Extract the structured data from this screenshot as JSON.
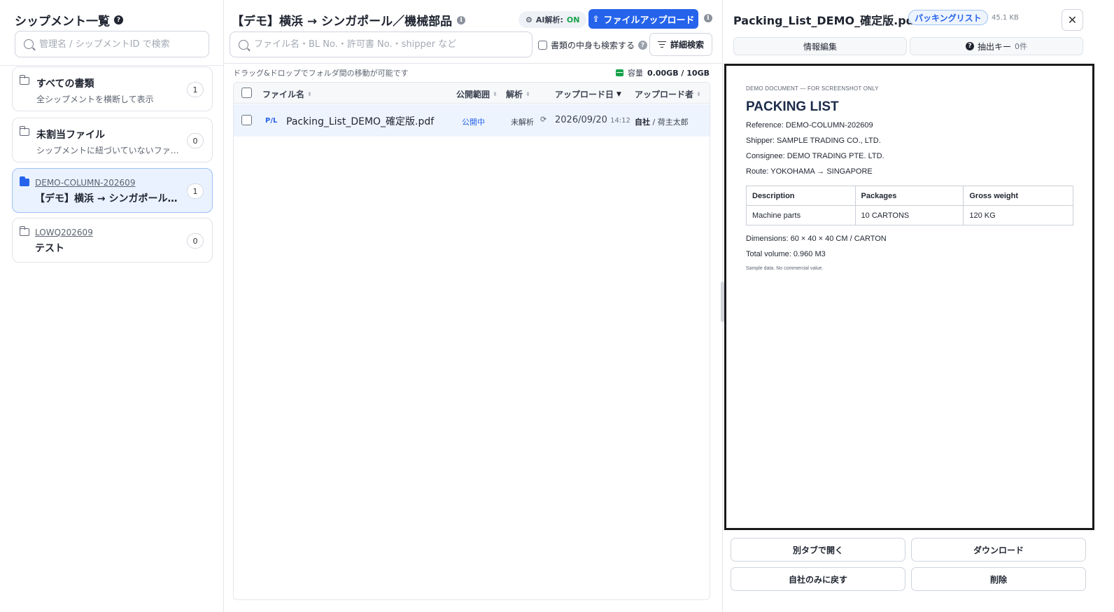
{
  "sidebar": {
    "title": "シップメント一覧",
    "search_placeholder": "管理名 / シップメントID で検索",
    "folders": [
      {
        "title": "すべての書類",
        "subtitle": "全シップメントを横断して表示",
        "count": "1"
      },
      {
        "title": "未割当ファイル",
        "subtitle": "シップメントに紐づいていないファイル",
        "count": "0"
      },
      {
        "id": "DEMO-COLUMN-202609",
        "name": "【デモ】横浜 → シンガポール／機械部品",
        "count": "1",
        "active": true
      },
      {
        "id": "LOWQ202609",
        "name": "テスト",
        "count": "0"
      }
    ]
  },
  "main": {
    "title": "【デモ】横浜 → シンガポール／機械部品",
    "ai_label": "AI解析:",
    "ai_state": "ON",
    "upload_label": "ファイルアップロード",
    "search_placeholder": "ファイル名・BL No.・許可書 No.・shipper など",
    "content_search_label": "書類の中身も検索する",
    "advanced_search_label": "詳細検索",
    "dnd_hint": "ドラッグ&ドロップでフォルダ間の移動が可能です",
    "capacity_label": "容量",
    "capacity_value": "0.00GB / 10GB",
    "columns": [
      "ファイル名",
      "公開範囲",
      "解析",
      "アップロード日",
      "アップロード者"
    ],
    "rows": [
      {
        "tag": "P/L",
        "filename": "Packing_List_DEMO_確定版.pdf",
        "visibility": "公開中",
        "analysis": "未解析",
        "date": "2026/09/20",
        "time": "14:12",
        "uploader_org": "自社",
        "uploader_sep": " / ",
        "uploader_name": "荷主太郎"
      }
    ]
  },
  "preview": {
    "filename": "Packing_List_DEMO_確定版.pdf",
    "type_badge": "パッキングリスト",
    "size": "45.1 KB",
    "tab_edit": "情報編集",
    "tab_keys": "抽出キー",
    "tab_keys_count": "0件",
    "doc": {
      "kicker": "DEMO DOCUMENT — FOR SCREENSHOT ONLY",
      "heading": "PACKING LIST",
      "reference": "Reference: DEMO-COLUMN-202609",
      "shipper": "Shipper: SAMPLE TRADING CO., LTD.",
      "consignee": "Consignee: DEMO TRADING PTE. LTD.",
      "route": "Route: YOKOHAMA → SINGAPORE",
      "table_headers": [
        "Description",
        "Packages",
        "Gross weight"
      ],
      "table_row": [
        "Machine parts",
        "10 CARTONS",
        "120 KG"
      ],
      "dimensions": "Dimensions: 60 × 40 × 40 CM / CARTON",
      "volume": "Total volume: 0.960 M3",
      "note": "Sample data. No commercial value."
    },
    "actions": {
      "open_tab": "別タブで開く",
      "download": "ダウンロード",
      "revert_private": "自社のみに戻す",
      "delete": "削除"
    }
  },
  "colors": {
    "primary": "#2563eb",
    "ai_on": "#16a34a",
    "active_folder_bg": "#eaf2ff"
  }
}
